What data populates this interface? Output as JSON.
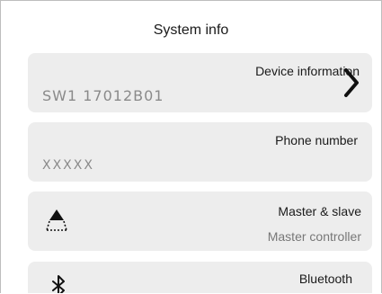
{
  "header": {
    "title": "System info"
  },
  "items": [
    {
      "title": "Device information",
      "value": "SW1 17012B01",
      "icon": "chevron-right-icon"
    },
    {
      "title": "Phone number",
      "value": "XXXXX"
    },
    {
      "title": "Master & slave",
      "value": "Master controller",
      "icon": "master-slave-icon"
    },
    {
      "title": "Bluetooth",
      "icon": "bluetooth-icon"
    }
  ]
}
